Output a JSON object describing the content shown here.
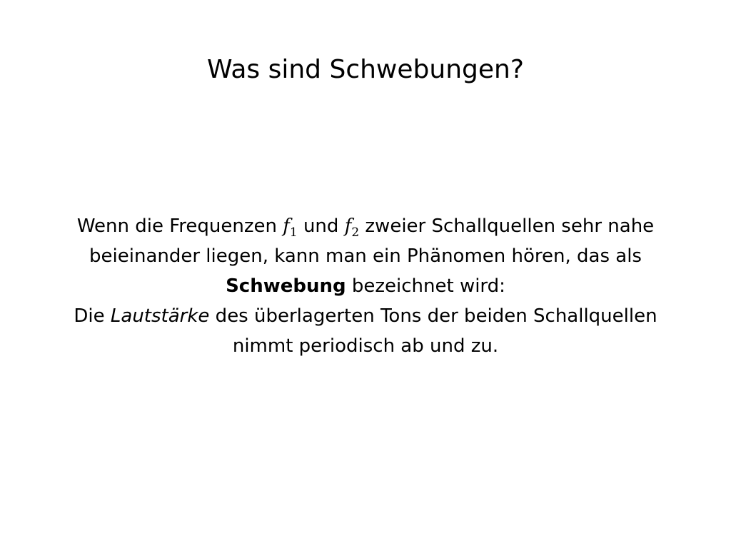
{
  "title": "Was sind Schwebungen?",
  "body": {
    "line1": {
      "prefix": "Wenn die Frequenzen ",
      "var1": "f",
      "sub1": "1",
      "middle": " und ",
      "var2": "f",
      "sub2": "2",
      "suffix": " zweier Schallquellen sehr nahe"
    },
    "line2": "beieinander liegen, kann man ein Phänomen hören, das als",
    "line3": {
      "term": "Schwebung",
      "suffix": " bezeichnet wird:"
    },
    "line4": {
      "prefix": "Die ",
      "emph": "Lautstärke",
      "suffix": " des überlagerten Tons der beiden Schallquellen"
    },
    "line5": "nimmt periodisch ab und zu."
  }
}
